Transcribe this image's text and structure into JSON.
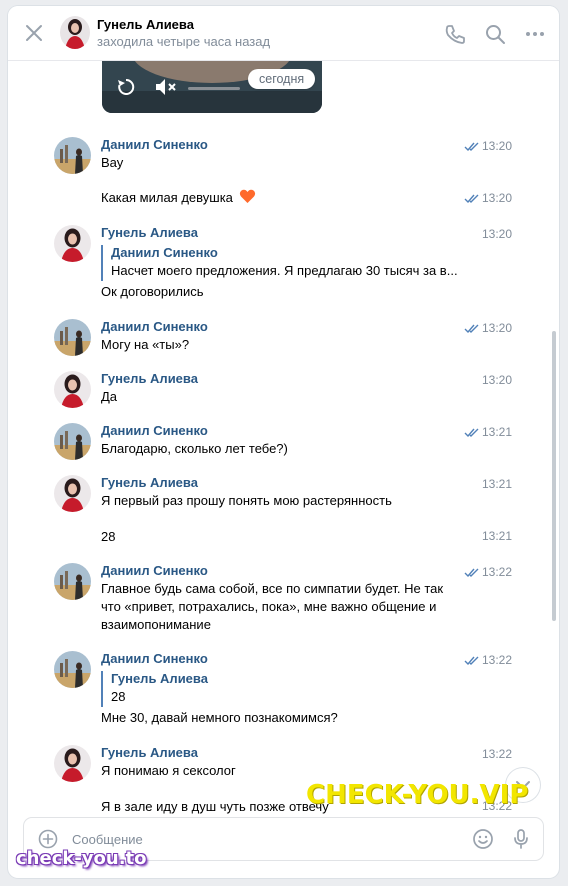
{
  "header": {
    "name": "Гунель Алиева",
    "status": "заходила четыре часа назад"
  },
  "chat": {
    "date_badge": "сегодня",
    "messages": [
      {
        "author": "Даниил Синенко",
        "text": "Вау",
        "time": "13:20",
        "read": true
      },
      {
        "text": "Какая милая девушка",
        "time": "13:20",
        "read": true
      },
      {
        "author": "Гунель Алиева",
        "time": "13:20",
        "quote_author": "Даниил Синенко",
        "quote_text": "Насчет моего предложения. Я предлагаю 30 тысяч за в...",
        "text": "Ок договорились"
      },
      {
        "author": "Даниил Синенко",
        "text": "Могу на «ты»?",
        "time": "13:20",
        "read": true
      },
      {
        "author": "Гунель Алиева",
        "text": "Да",
        "time": "13:20"
      },
      {
        "author": "Даниил Синенко",
        "text": "Благодарю, сколько лет тебе?)",
        "time": "13:21",
        "read": true
      },
      {
        "author": "Гунель Алиева",
        "text": "Я первый раз прошу понять мою растерянность",
        "time": "13:21"
      },
      {
        "text": "28",
        "time": "13:21"
      },
      {
        "author": "Даниил Синенко",
        "text": "Главное будь сама собой, все по симпатии будет. Не так что «привет, потрахались, пока», мне важно общение и взаимопонимание",
        "time": "13:22",
        "read": true
      },
      {
        "author": "Даниил Синенко",
        "time": "13:22",
        "read": true,
        "quote_author": "Гунель Алиева",
        "quote_text": "28",
        "text": "Мне 30, давай немного познакомимся?"
      },
      {
        "author": "Гунель Алиева",
        "text": "Я понимаю я сексолог",
        "time": "13:22"
      },
      {
        "text": "Я в зале иду в душ чуть позже отвечу",
        "time": "13:22"
      }
    ]
  },
  "composer": {
    "placeholder": "Сообщение"
  },
  "watermarks": {
    "main": "CHECK-YOU.VIP",
    "corner": "check-you.to"
  },
  "colors": {
    "link": "#2a5885",
    "muted": "#818c99",
    "accent": "#5181b8",
    "heart": "#ff6a2c"
  },
  "icons": [
    "close-icon",
    "phone-icon",
    "search-icon",
    "more-icon",
    "replay-icon",
    "mute-icon",
    "read-check-icon",
    "heart-emoji-icon",
    "attach-plus-icon",
    "smile-icon",
    "mic-icon",
    "chevron-down-icon"
  ]
}
